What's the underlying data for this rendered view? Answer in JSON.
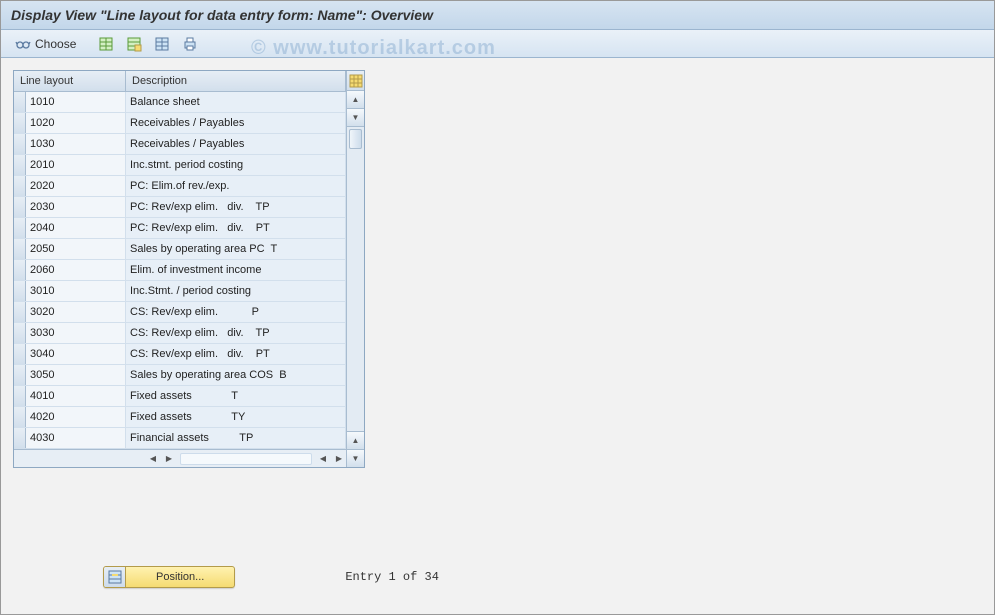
{
  "title": "Display View \"Line layout for data entry form: Name\": Overview",
  "watermark": "© www.tutorialkart.com",
  "toolbar": {
    "choose_label": "Choose"
  },
  "table": {
    "headers": {
      "col1": "Line layout",
      "col2": "Description"
    },
    "rows": [
      {
        "c1": "1010",
        "c2": "Balance sheet"
      },
      {
        "c1": "1020",
        "c2": "Receivables / Payables"
      },
      {
        "c1": "1030",
        "c2": "Receivables / Payables"
      },
      {
        "c1": "2010",
        "c2": "Inc.stmt. period costing"
      },
      {
        "c1": "2020",
        "c2": "PC: Elim.of rev./exp."
      },
      {
        "c1": "2030",
        "c2": "PC: Rev/exp elim.   div.    TP"
      },
      {
        "c1": "2040",
        "c2": "PC: Rev/exp elim.   div.    PT"
      },
      {
        "c1": "2050",
        "c2": "Sales by operating area PC  T"
      },
      {
        "c1": "2060",
        "c2": "Elim. of investment income"
      },
      {
        "c1": "3010",
        "c2": "Inc.Stmt. / period costing"
      },
      {
        "c1": "3020",
        "c2": "CS: Rev/exp elim.           P"
      },
      {
        "c1": "3030",
        "c2": "CS: Rev/exp elim.   div.    TP"
      },
      {
        "c1": "3040",
        "c2": "CS: Rev/exp elim.   div.    PT"
      },
      {
        "c1": "3050",
        "c2": "Sales by operating area COS  B"
      },
      {
        "c1": "4010",
        "c2": "Fixed assets             T"
      },
      {
        "c1": "4020",
        "c2": "Fixed assets             TY"
      },
      {
        "c1": "4030",
        "c2": "Financial assets          TP"
      }
    ]
  },
  "position_label": "Position...",
  "entry_text": "Entry 1 of 34"
}
